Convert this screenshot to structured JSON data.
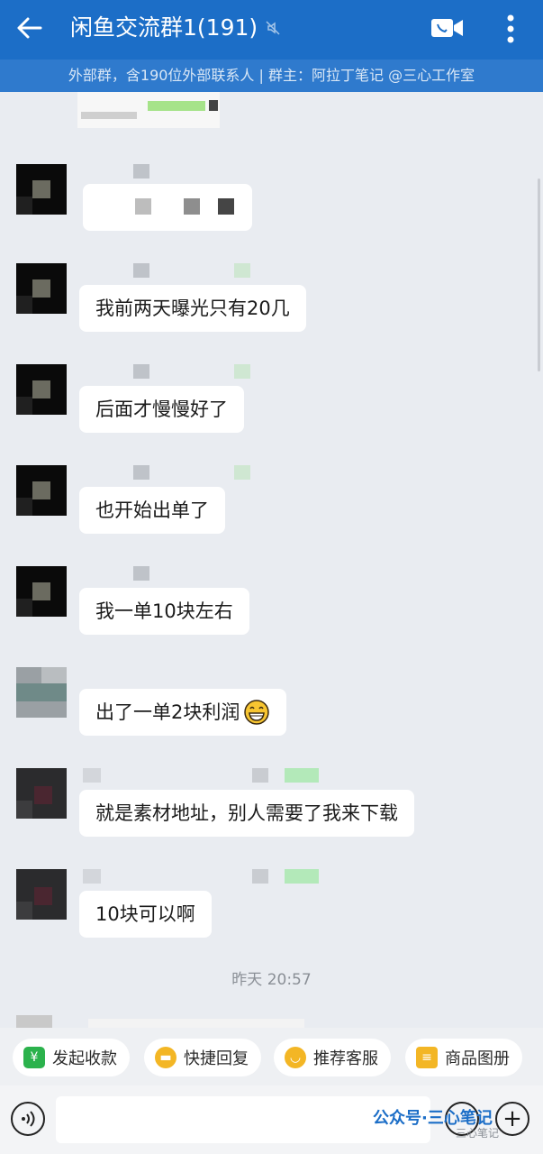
{
  "header": {
    "title": "闲鱼交流群1(191)",
    "subtitle": "外部群，含190位外部联系人 | 群主：阿拉丁笔记 @三心工作室"
  },
  "messages": [
    {
      "text": ""
    },
    {
      "text": "我前两天曝光只有20几"
    },
    {
      "text": "后面才慢慢好了"
    },
    {
      "text": "也开始出单了"
    },
    {
      "text": "我一单10块左右"
    },
    {
      "text": "出了一单2块利润",
      "emoji": "grin-emoji"
    },
    {
      "text": "就是素材地址，别人需要了我来下载"
    },
    {
      "text": "10块可以啊"
    }
  ],
  "timestamp": "昨天  20:57",
  "quick_replies": [
    {
      "label": "发起收款",
      "icon": "payment-icon",
      "color": "#2bb24c"
    },
    {
      "label": "快捷回复",
      "icon": "reply-icon",
      "color": "#f3b625"
    },
    {
      "label": "推荐客服",
      "icon": "service-icon",
      "color": "#f3b625"
    },
    {
      "label": "商品图册",
      "icon": "catalog-icon",
      "color": "#f3b625"
    }
  ],
  "watermark": {
    "main": "公众号·三心笔记",
    "sub": "三心笔记"
  },
  "colors": {
    "header_bg": "#1c6ec7",
    "subbar_bg": "#2f7acd",
    "chat_bg": "#e9ecf1"
  }
}
